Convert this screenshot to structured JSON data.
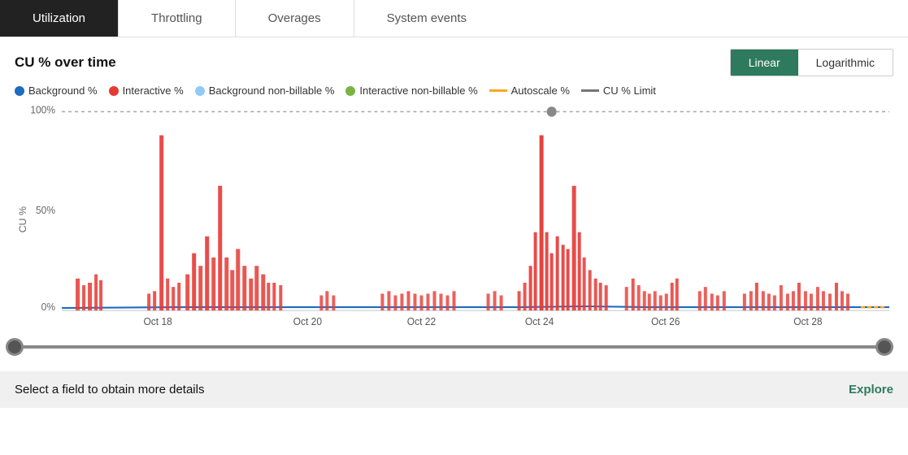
{
  "tabs": [
    {
      "label": "Utilization",
      "active": true
    },
    {
      "label": "Throttling",
      "active": false
    },
    {
      "label": "Overages",
      "active": false
    },
    {
      "label": "System events",
      "active": false
    }
  ],
  "chart": {
    "title": "CU % over time",
    "scale_linear": "Linear",
    "scale_logarithmic": "Logarithmic",
    "y_labels": [
      "100%",
      "50%",
      "0%"
    ],
    "x_labels": [
      "Oct 18",
      "Oct 20",
      "Oct 22",
      "Oct 24",
      "Oct 26",
      "Oct 28"
    ],
    "y_axis_label": "CU %"
  },
  "legend": [
    {
      "label": "Background %",
      "color": "#1e6bbf",
      "type": "dot"
    },
    {
      "label": "Interactive %",
      "color": "#e53935",
      "type": "dot"
    },
    {
      "label": "Background non-billable %",
      "color": "#90caf9",
      "type": "dot"
    },
    {
      "label": "Interactive non-billable %",
      "color": "#7cb342",
      "type": "dot"
    },
    {
      "label": "Autoscale %",
      "color": "#f9a825",
      "type": "dash"
    },
    {
      "label": "CU % Limit",
      "color": "#757575",
      "type": "dash"
    }
  ],
  "bottom": {
    "text": "Select a field to obtain more details",
    "explore": "Explore"
  }
}
